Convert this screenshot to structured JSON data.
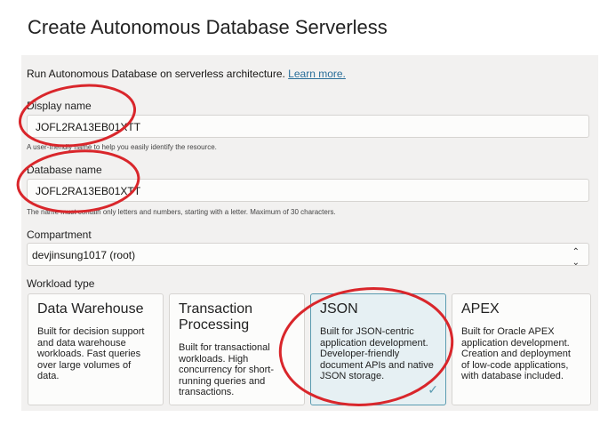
{
  "header": {
    "title": "Create Autonomous Database Serverless"
  },
  "intro": {
    "text": "Run Autonomous Database on serverless architecture.",
    "link": "Learn more."
  },
  "display_name": {
    "label": "Display name",
    "value": "JOFL2RA13EB01XTT",
    "help": "A user-friendly name to help you easily identify the resource."
  },
  "database_name": {
    "label": "Database name",
    "value": "JOFL2RA13EB01XTT",
    "help": "The name must contain only letters and numbers, starting with a letter. Maximum of 30 characters."
  },
  "compartment": {
    "label": "Compartment",
    "value": "devjinsung1017 (root)"
  },
  "workload": {
    "label": "Workload type",
    "selected": "JSON",
    "cards": [
      {
        "title": "Data Warehouse",
        "desc": "Built for decision support and data warehouse workloads. Fast queries over large volumes of data."
      },
      {
        "title": "Transaction Processing",
        "desc": "Built for transactional workloads. High concurrency for short-running queries and transactions."
      },
      {
        "title": "JSON",
        "desc": "Built for JSON-centric application development. Developer-friendly document APIs and native JSON storage."
      },
      {
        "title": "APEX",
        "desc": "Built for Oracle APEX application development. Creation and deployment of low-code applications, with database included."
      }
    ]
  },
  "annotation_color": "#d9262b"
}
